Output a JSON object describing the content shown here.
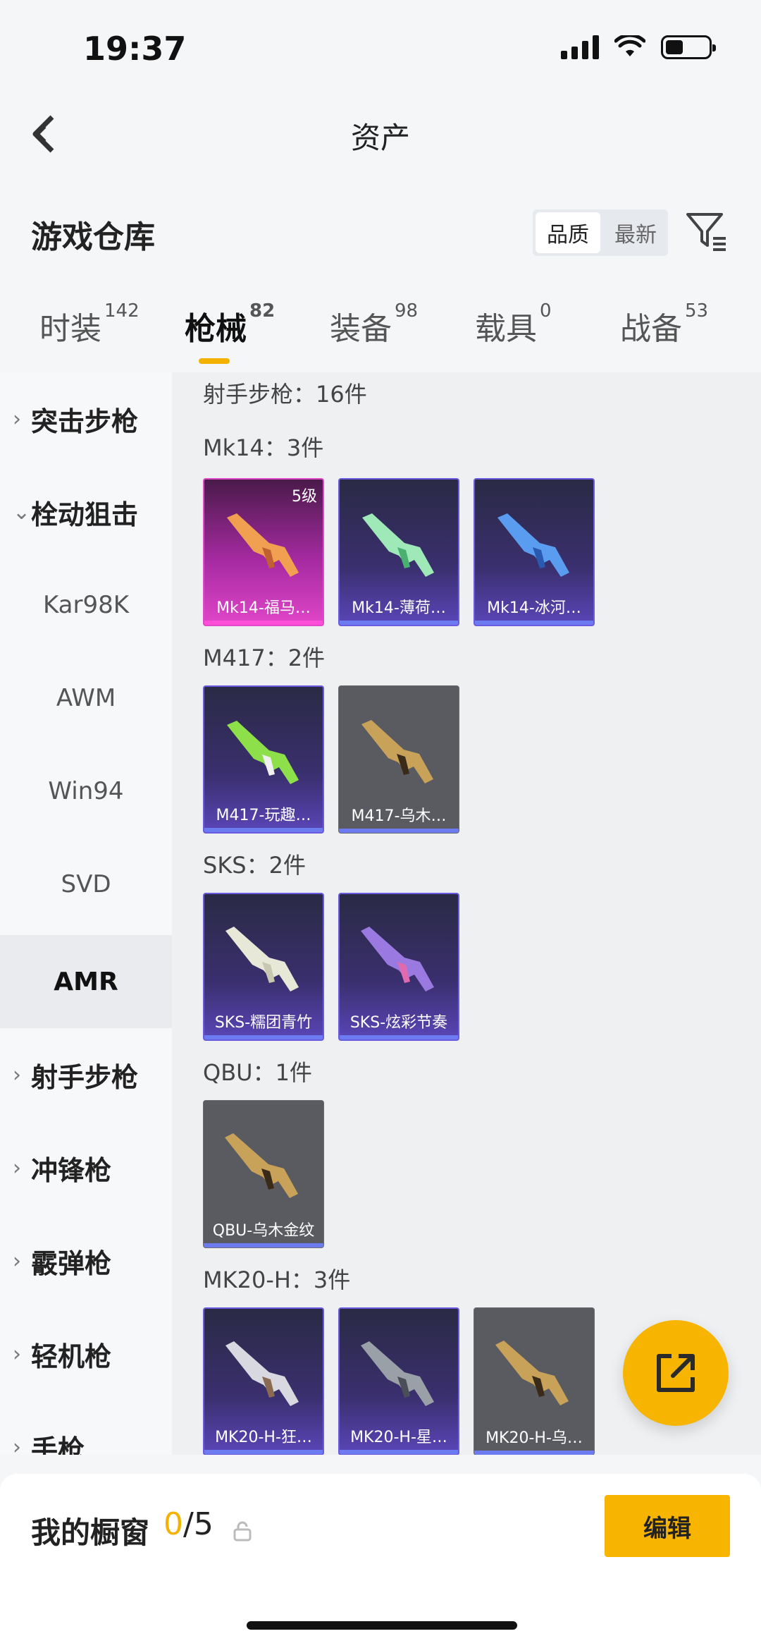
{
  "status": {
    "time": "19:37"
  },
  "nav": {
    "title": "资产",
    "back_icon": "back-chevron-icon"
  },
  "header": {
    "title": "游戏仓库",
    "sort": {
      "quality": "品质",
      "latest": "最新",
      "selected": "quality"
    },
    "filter_icon": "filter-icon"
  },
  "tabs": [
    {
      "label": "时装",
      "count": "142"
    },
    {
      "label": "枪械",
      "count": "82",
      "active": true
    },
    {
      "label": "装备",
      "count": "98"
    },
    {
      "label": "载具",
      "count": "0"
    },
    {
      "label": "战备",
      "count": "53"
    }
  ],
  "sidebar": {
    "items": [
      {
        "label": "突击步枪",
        "chevron": "›"
      },
      {
        "label": "栓动狙击",
        "chevron": "⌄"
      },
      {
        "label": "Kar98K"
      },
      {
        "label": "AWM"
      },
      {
        "label": "Win94"
      },
      {
        "label": "SVD"
      },
      {
        "label": "AMR",
        "selected": true
      },
      {
        "label": "射手步枪",
        "chevron": "›"
      },
      {
        "label": "冲锋枪",
        "chevron": "›"
      },
      {
        "label": "霰弹枪",
        "chevron": "›"
      },
      {
        "label": "轻机枪",
        "chevron": "›"
      },
      {
        "label": "手枪",
        "chevron": "›"
      }
    ]
  },
  "content": {
    "category": "射手步枪：16件",
    "groups": [
      {
        "title": "Mk14：3件",
        "items": [
          {
            "name": "Mk14-福马…",
            "level": "5级",
            "style": "pink"
          },
          {
            "name": "Mk14-薄荷…",
            "style": "purple"
          },
          {
            "name": "Mk14-冰河…",
            "style": "purple"
          }
        ]
      },
      {
        "title": "M417：2件",
        "items": [
          {
            "name": "M417-玩趣…",
            "style": "purple"
          },
          {
            "name": "M417-乌木…",
            "style": "grey"
          }
        ]
      },
      {
        "title": "SKS：2件",
        "items": [
          {
            "name": "SKS-糯团青竹",
            "style": "purple"
          },
          {
            "name": "SKS-炫彩节奏",
            "style": "purple"
          }
        ]
      },
      {
        "title": "QBU：1件",
        "items": [
          {
            "name": "QBU-乌木金纹",
            "style": "grey"
          }
        ]
      },
      {
        "title": "MK20-H：3件",
        "items": [
          {
            "name": "MK20-H-狂…",
            "style": "purple"
          },
          {
            "name": "MK20-H-星…",
            "style": "purple"
          },
          {
            "name": "MK20-H-乌…",
            "style": "grey"
          }
        ]
      }
    ]
  },
  "fab": {
    "icon": "share-external-icon"
  },
  "footer": {
    "title": "我的橱窗",
    "current": "0",
    "total": "/5",
    "lock_icon": "lock-icon",
    "edit_label": "编辑"
  },
  "colors": {
    "accent": "#F7B400",
    "purple_card": "#3A2F6E",
    "pink_card": "#E046C8",
    "grey_card": "#5A5B60"
  }
}
